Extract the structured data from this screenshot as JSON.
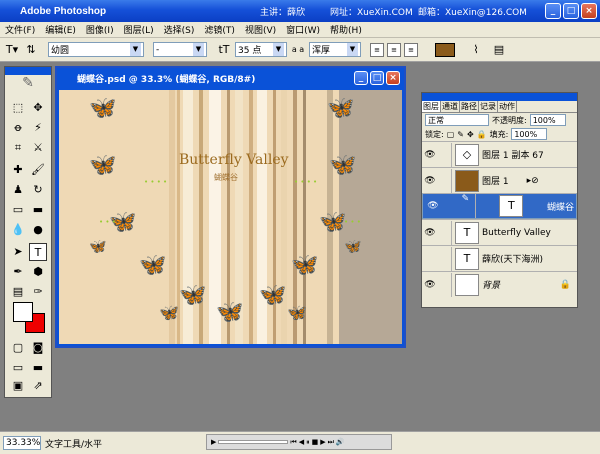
{
  "titlebar": {
    "app": "Adobe Photoshop",
    "host": "主讲：薛欣",
    "site": "网址：XueXin.COM",
    "mail": "邮箱：XueXin@126.COM"
  },
  "menu": [
    "文件(F)",
    "编辑(E)",
    "图像(I)",
    "图层(L)",
    "选择(S)",
    "滤镜(T)",
    "视图(V)",
    "窗口(W)",
    "帮助(H)"
  ],
  "options": {
    "font_family": "幼圆",
    "font_style": "-",
    "font_size": "35 点",
    "antialias": "浑厚",
    "antialias_label": "a a",
    "color": "#8a5a1a"
  },
  "document": {
    "title": "蝴蝶谷.psd @ 33.3% (蝴蝶谷, RGB/8#)",
    "heading": "Butterfly Valley",
    "subheading": "蝴蝶谷"
  },
  "layers_panel": {
    "tabs": [
      "图层",
      "通道",
      "路径",
      "记录",
      "动作"
    ],
    "blend_mode": "正常",
    "opacity_label": "不透明度:",
    "opacity": "100%",
    "lock_label": "锁定:",
    "fill_label": "填充:",
    "fill": "100%",
    "layers": [
      {
        "name": "图层 1 副本 67",
        "thumb": "◇",
        "selected": false,
        "visible": true
      },
      {
        "name": "图层 1",
        "thumb": "",
        "selected": false,
        "visible": true
      },
      {
        "name": "蝴蝶谷",
        "thumb": "T",
        "selected": true,
        "visible": true
      },
      {
        "name": "Butterfly Valley",
        "thumb": "T",
        "selected": false,
        "visible": true
      },
      {
        "name": "薛欣(天下海洲)",
        "thumb": "T",
        "selected": false,
        "visible": false
      },
      {
        "name": "背景",
        "thumb": "",
        "selected": false,
        "visible": true
      }
    ]
  },
  "status": {
    "zoom": "33.33%",
    "tool": "文字工具/水平"
  },
  "colors": {
    "foreground": "#ffffff",
    "background": "#e00000",
    "selected_layer": "#3169c6",
    "title_bar": "#0a52d8"
  }
}
